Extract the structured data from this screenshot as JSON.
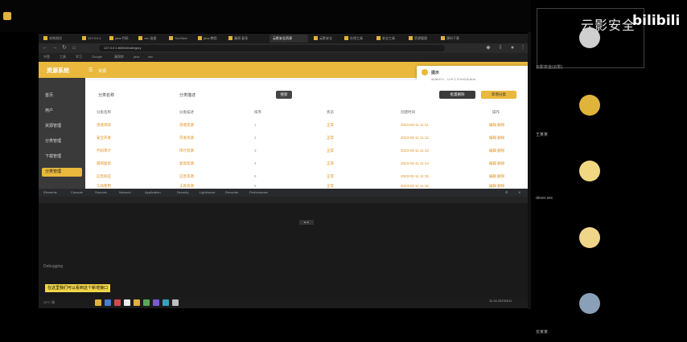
{
  "watermark": {
    "text": "云影安全",
    "brand": "bilibili"
  },
  "participants": [
    {
      "name": "云影安全(云影)"
    },
    {
      "name": "王某某"
    },
    {
      "name": "dever.sec"
    },
    {
      "name": ""
    },
    {
      "name": "安某某"
    }
  ],
  "browser": {
    "tabs": [
      "本地测试",
      "127.0.0.1",
      "java 代码",
      "vnc 连接",
      "YouTube",
      "java 教程",
      "漏洞 复现",
      "云影安全",
      "在线工具",
      "安全工具",
      "资源管理",
      "源码下载"
    ],
    "active_tab": "云影安全资源",
    "address": "127.0.0.1:8080/#/category",
    "bookmarks": [
      "书签",
      "工具",
      "学习",
      "Google",
      "漏洞库",
      "java",
      "sec"
    ]
  },
  "app": {
    "logo": "资源系统",
    "crumb": "资源",
    "sidebar": [
      "首页",
      "用户",
      "资源管理",
      "分类管理",
      "下载管理",
      "分类管理"
    ],
    "search_label": "分类名称",
    "search_label2": "分类描述",
    "search_button": "搜索",
    "add_button": "新增分类",
    "batch_button": "批量删除",
    "notification": {
      "title": "提示",
      "text": "新增成功 · 分类已添加到系统中"
    },
    "columns": [
      "分类名称",
      "分类描述",
      "排序",
      "状态",
      "创建时间",
      "操作"
    ],
    "rows": [
      {
        "name": "渗透测试",
        "desc": "渗透资源",
        "order": "1",
        "status": "正常",
        "time": "2023-03-11 11:11",
        "ops": "编辑 删除"
      },
      {
        "name": "安全开发",
        "desc": "开发资源",
        "order": "2",
        "status": "正常",
        "time": "2023-03-11 11:12",
        "ops": "编辑 删除"
      },
      {
        "name": "代码审计",
        "desc": "审计资源",
        "order": "3",
        "status": "正常",
        "time": "2023-03-11 11:13",
        "ops": "编辑 删除"
      },
      {
        "name": "漏洞复现",
        "desc": "复现资源",
        "order": "4",
        "status": "正常",
        "time": "2023-03-11 11:14",
        "ops": "编辑 删除"
      },
      {
        "name": "应急响应",
        "desc": "应急资源",
        "order": "5",
        "status": "正常",
        "time": "2023-03-11 11:15",
        "ops": "编辑 删除"
      },
      {
        "name": "工具使用",
        "desc": "工具资源",
        "order": "6",
        "status": "正常",
        "time": "2023-03-11 11:16",
        "ops": "编辑 删除"
      }
    ]
  },
  "devtools": {
    "tabs": [
      "Elements",
      "Console",
      "Sources",
      "Network",
      "Application",
      "Security",
      "Lighthouse",
      "Recorder",
      "Performance"
    ],
    "status": "Debugging",
    "center": "■ ■"
  },
  "subtitle": "在这里我们可以看到这个新增接口",
  "taskbar": {
    "left": "25°C 晴",
    "clock": "11:16 2023/3/11"
  },
  "colors": {
    "accent": "#e9b83c",
    "table_text": "#e09020"
  }
}
